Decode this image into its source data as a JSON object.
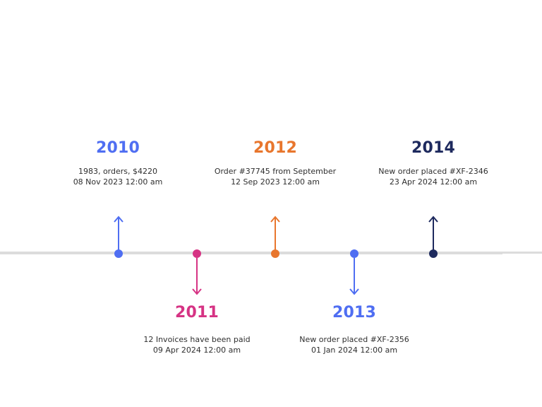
{
  "events": [
    {
      "year": "2010",
      "title": "1983, orders, $4220",
      "date": "08 Nov 2023 12:00 am",
      "color": "#4f6ef2",
      "position": "above"
    },
    {
      "year": "2011",
      "title": "12 Invoices have been paid",
      "date": "09 Apr 2024 12:00 am",
      "color": "#d63384",
      "position": "below"
    },
    {
      "year": "2012",
      "title": "Order #37745 from September",
      "date": "12 Sep 2023 12:00 am",
      "color": "#e8762d",
      "position": "above"
    },
    {
      "year": "2013",
      "title": "New order placed #XF-2356",
      "date": "01 Jan 2024 12:00 am",
      "color": "#4f6ef2",
      "position": "below"
    },
    {
      "year": "2014",
      "title": "New order placed #XF-2346",
      "date": "23 Apr 2024 12:00 am",
      "color": "#1e2a5e",
      "position": "above"
    }
  ],
  "line_color": "#dcdcdc"
}
